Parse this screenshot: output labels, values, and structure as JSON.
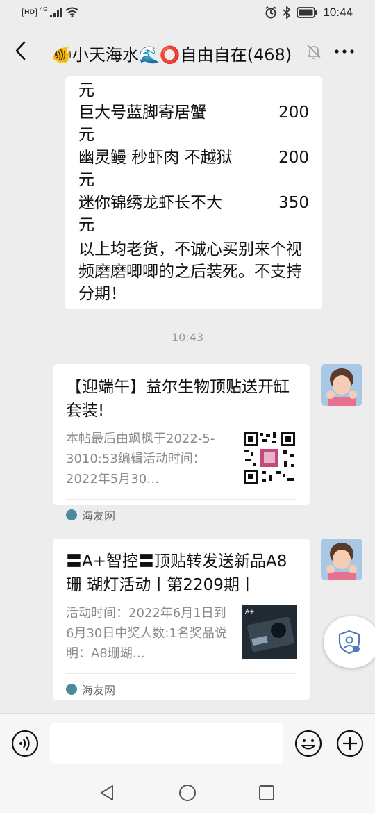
{
  "status_bar": {
    "network_badge": "HD",
    "network_type": "4G",
    "time": "10:44"
  },
  "header": {
    "title": "🐠小天海水🌊⭕自由自在(468)",
    "icons": [
      "back-icon",
      "mute-bell-icon",
      "more-icon"
    ]
  },
  "messages": {
    "product_list": {
      "first_unit": "元",
      "items": [
        {
          "name": "巨大号蓝脚寄居蟹",
          "price": "200",
          "unit": "元"
        },
        {
          "name": "幽灵鳗 秒虾肉  不越狱",
          "price": "200",
          "unit": "元"
        },
        {
          "name": "迷你锦绣龙虾长不大",
          "price": "350",
          "unit": "元"
        }
      ],
      "note": "以上均老货，不诚心买别来个视频磨磨唧唧的之后装死。不支持分期！"
    },
    "timestamp": "10:43",
    "cards": [
      {
        "title": "【迎端午】益尔生物顶贴送开缸套装!",
        "desc": "本帖最后由飒枫于2022-5-3010:53编辑活动时间：2022年5月30…",
        "source": "海友网",
        "thumb_type": "qr-code"
      },
      {
        "title": "〓A+智控〓顶贴转发送新品A8珊 瑚灯活动丨第2209期丨",
        "desc": "活动时间：2022年6月1日到6月30日中奖人数:1名奖品说明：A8珊瑚…",
        "source": "海友网",
        "thumb_type": "product-photo",
        "thumb_label": "A+"
      }
    ]
  },
  "input_bar": {
    "placeholder": "",
    "icons": [
      "voice-icon",
      "emoji-icon",
      "plus-icon"
    ]
  },
  "nav_bar": {
    "icons": [
      "nav-back-icon",
      "nav-home-icon",
      "nav-recent-icon"
    ]
  },
  "colors": {
    "background": "#ededed",
    "bubble": "#ffffff",
    "muted_text": "#8a8a8a"
  }
}
